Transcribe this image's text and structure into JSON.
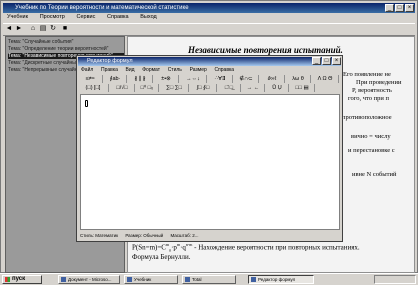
{
  "main_window": {
    "title": "Учебник по Теории вероятности и математической статистике",
    "menu": [
      "Учебник",
      "Просмотр",
      "Сервис",
      "Справка",
      "Выход"
    ]
  },
  "topics": [
    {
      "label": "Тема: \"Случайные события\""
    },
    {
      "label": "Тема: \"Определение теории вероятностей\""
    },
    {
      "label": "Тема: \"Независимые повторения испытаний\""
    },
    {
      "label": "Тема: \"Дискретные случайные величины\""
    },
    {
      "label": "Тема: \"Непрерывные случайные величины\""
    }
  ],
  "content": {
    "heading": "Независимые повторения испытаний.",
    "lines": [
      "Его появление не",
      "При проведении",
      "P, вероятность",
      "гого, что при п",
      "противоположное",
      "вично = числу",
      "и перестановке с",
      "ивне N событий"
    ],
    "formula": "P(Sn=m)=C",
    "formula_parts": {
      "sup1": "m",
      "sub1": "n",
      "mid": "·p",
      "sup2": "m",
      "mid2": "·q",
      "sup3": "n-m",
      "tail": " - Нахождение вероятности при повторных испытаниях."
    },
    "formula_caption": "Формула Бернулли."
  },
  "editor": {
    "title": "Редактор формул",
    "menu": [
      "Файл",
      "Правка",
      "Вид",
      "Формат",
      "Стиль",
      "Размер",
      "Справка"
    ],
    "row1": [
      "≤≠≈",
      "∮ab·",
      "∦ ∥ ∦",
      "±•⊗",
      "→⇔↓",
      "∴∀∃",
      "∉∩⊂",
      "∂∞ℓ",
      "λω θ",
      "Λ Ω Θ"
    ],
    "row2": [
      "(□) [□]",
      "□/√□",
      "□⁰ □₀",
      "∑□ ∑□",
      "∫□ ∮□",
      "□̄ □̲",
      "→ ←",
      "Ů Ụ",
      "□□ ▤"
    ],
    "status": [
      "Стиль: Математик",
      "Размер: Обычный",
      "Масштаб: 2..."
    ]
  },
  "taskbar": {
    "start": "пуск",
    "tasks": [
      "Документ - Microso...",
      "Учебник",
      "Total",
      "Редактор формул"
    ],
    "clock": ""
  }
}
